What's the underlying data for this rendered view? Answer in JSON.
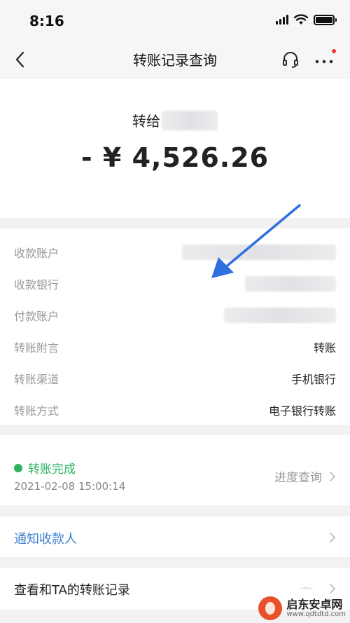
{
  "status_bar": {
    "time": "8:16"
  },
  "nav": {
    "title": "转账记录查询"
  },
  "transfer": {
    "recipient_label": "转给",
    "amount": "- ¥ 4,526.26"
  },
  "details": [
    {
      "label": "收款账户",
      "value": ""
    },
    {
      "label": "收款银行",
      "value": ""
    },
    {
      "label": "付款账户",
      "value": ""
    },
    {
      "label": "转账附言",
      "value": "转账"
    },
    {
      "label": "转账渠道",
      "value": "手机银行"
    },
    {
      "label": "转账方式",
      "value": "电子银行转账"
    }
  ],
  "status": {
    "text": "转账完成",
    "datetime": "2021-02-08 15:00:14",
    "progress_label": "进度查询",
    "color": "#2db360"
  },
  "actions": {
    "notify_label": "通知收款人",
    "records_label": "查看和TA的转账记录"
  },
  "annotation": {
    "arrow_color": "#2f6fe0"
  },
  "watermark": {
    "title": "启东安卓网",
    "url": "www.qdtdtd.com"
  },
  "icons": [
    "back-icon",
    "headset-icon",
    "more-icon",
    "chevron-right-icon"
  ]
}
